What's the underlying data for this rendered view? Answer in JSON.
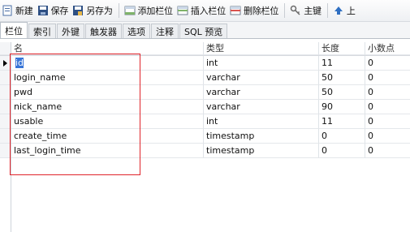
{
  "toolbar": {
    "new_label": "新建",
    "save_label": "保存",
    "save_as_label": "另存为",
    "add_field_label": "添加栏位",
    "insert_field_label": "插入栏位",
    "delete_field_label": "删除栏位",
    "primary_key_label": "主键",
    "move_up_label": "上"
  },
  "tabs": [
    "栏位",
    "索引",
    "外键",
    "触发器",
    "选项",
    "注释",
    "SQL 预览"
  ],
  "columns": {
    "name": "名",
    "type": "类型",
    "length": "长度",
    "decimals": "小数点"
  },
  "rows": [
    {
      "name": "id",
      "type": "int",
      "length": "11",
      "decimals": "0"
    },
    {
      "name": "login_name",
      "type": "varchar",
      "length": "50",
      "decimals": "0"
    },
    {
      "name": "pwd",
      "type": "varchar",
      "length": "50",
      "decimals": "0"
    },
    {
      "name": "nick_name",
      "type": "varchar",
      "length": "90",
      "decimals": "0"
    },
    {
      "name": "usable",
      "type": "int",
      "length": "11",
      "decimals": "0"
    },
    {
      "name": "create_time",
      "type": "timestamp",
      "length": "0",
      "decimals": "0"
    },
    {
      "name": "last_login_time",
      "type": "timestamp",
      "length": "0",
      "decimals": "0"
    }
  ],
  "colors": {
    "selection": "#3875d7",
    "highlight_box": "#e0242b"
  }
}
